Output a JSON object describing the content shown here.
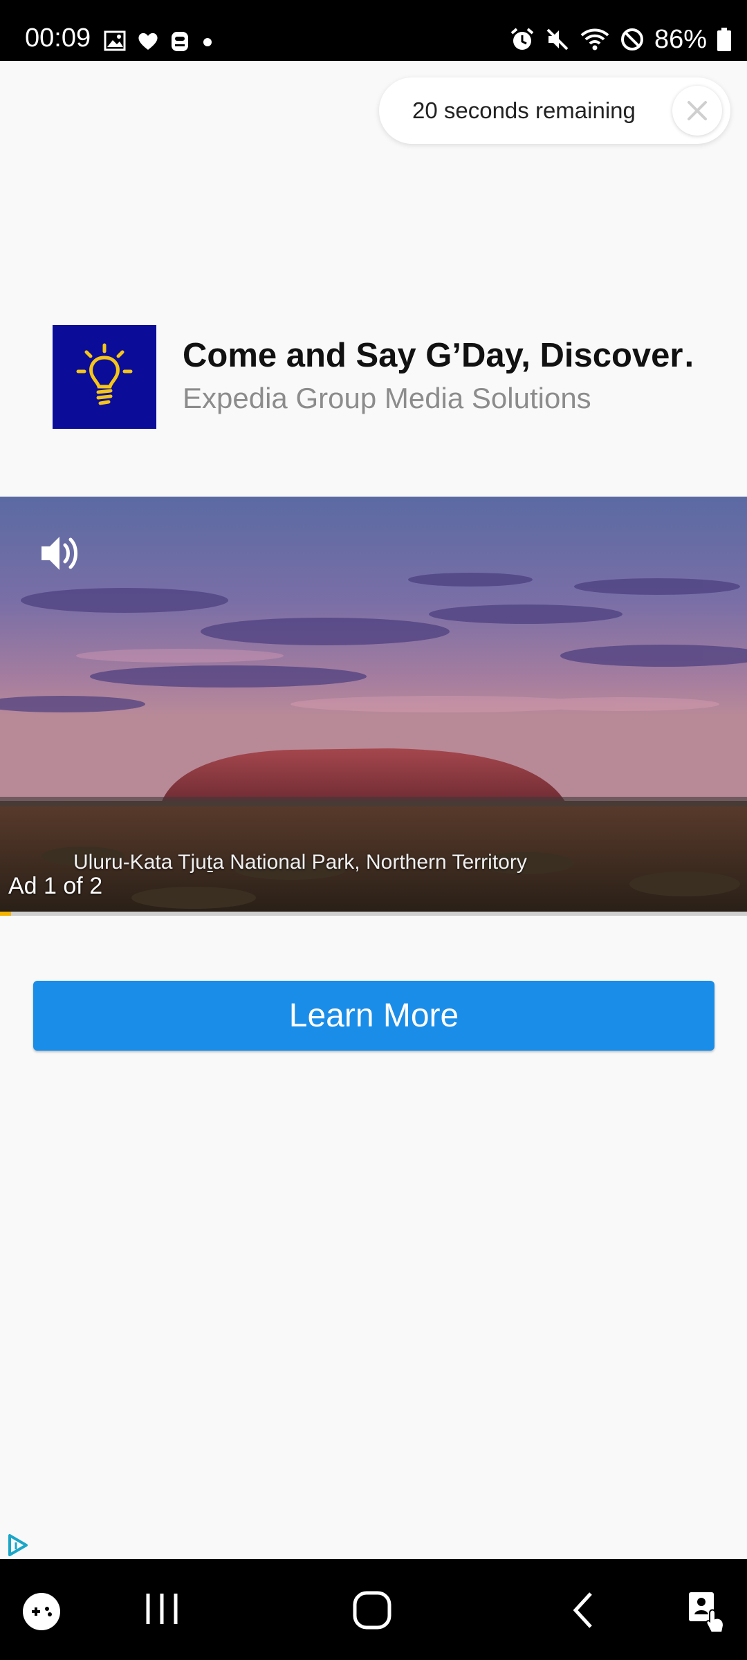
{
  "status_bar": {
    "time": "00:09",
    "battery": "86%",
    "left_icons": [
      "image-icon",
      "heart-icon",
      "app-icon",
      "dot-icon"
    ],
    "right_icons": [
      "alarm-icon",
      "mute-icon",
      "wifi-icon",
      "no-disturb-icon",
      "battery-icon"
    ]
  },
  "countdown": {
    "text": "20 seconds remaining"
  },
  "advertiser": {
    "title": "Come and Say G’Day, Discover…",
    "name": "Expedia Group Media Solutions",
    "logo_icon": "lightbulb-icon",
    "logo_color": "#0b0c98"
  },
  "video": {
    "caption": "Uluru-Kata Tjuṯa National Park, Northern Territory",
    "ad_counter": "Ad 1 of 2",
    "progress": 0.015
  },
  "cta": {
    "label": "Learn More",
    "color": "#1a8de8"
  },
  "nav_bar": {
    "icons": [
      "game-launcher-icon",
      "recents-icon",
      "home-icon",
      "back-icon",
      "accessibility-icon"
    ]
  }
}
